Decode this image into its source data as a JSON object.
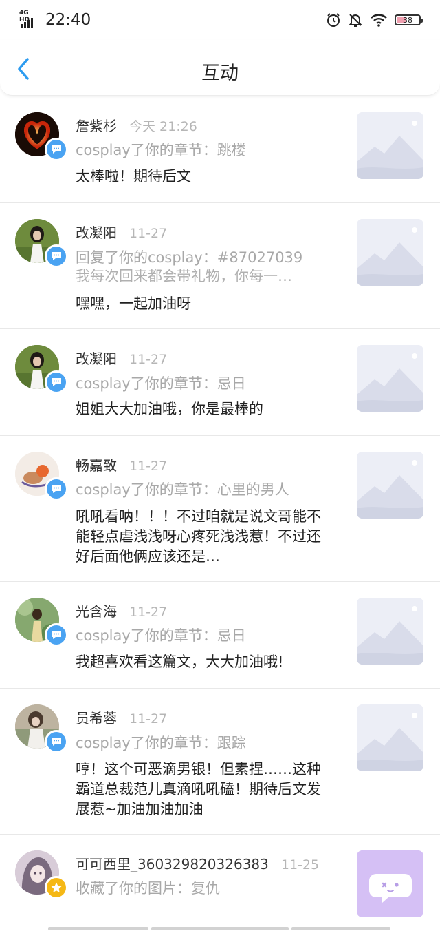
{
  "status_bar": {
    "network": "4G HD",
    "time": "22:40",
    "battery": "38",
    "icons": [
      "alarm-icon",
      "mute-bell-icon",
      "wifi-icon",
      "battery-icon"
    ]
  },
  "header": {
    "title": "互动",
    "back_icon": "chevron-left-icon"
  },
  "colors": {
    "accent": "#4aa3f2",
    "star": "#f5b816",
    "time": "#b6b6b6",
    "action": "#a8a8a8",
    "purple": "#d5c0f5"
  },
  "items": [
    {
      "name": "詹紫杉",
      "time": "今天 21:26",
      "action": "cosplay了你的章节：跳楼",
      "comment": "太棒啦！期待后文",
      "badge": "message-icon"
    },
    {
      "name": "改凝阳",
      "time": "11-27",
      "action": "回复了你的cosplay：#87027039",
      "quote": "我每次回来都会带礼物，你每一…",
      "comment": "嘿嘿，一起加油呀",
      "badge": "message-icon"
    },
    {
      "name": "改凝阳",
      "time": "11-27",
      "action": "cosplay了你的章节：忌日",
      "comment": "姐姐大大加油哦，你是最棒的",
      "badge": "message-icon"
    },
    {
      "name": "畅嘉致",
      "time": "11-27",
      "action": "cosplay了你的章节：心里的男人",
      "comment": "吼吼看呐！！！不过咱就是说文哥能不能轻点虐浅浅呀心疼死浅浅惹！不过还好后面他俩应该还是…",
      "badge": "message-icon"
    },
    {
      "name": "光含海",
      "time": "11-27",
      "action": "cosplay了你的章节：忌日",
      "comment": "我超喜欢看这篇文，大大加油哦!",
      "badge": "message-icon"
    },
    {
      "name": "员希蓉",
      "time": "11-27",
      "action": "cosplay了你的章节：跟踪",
      "comment": "哼！这个可恶滴男银！但素捏……这种霸道总裁范儿真滴吼吼磕！期待后文发展惹~加油加油加油",
      "badge": "message-icon"
    },
    {
      "name": "可可西里_360329820326383",
      "time": "11-25",
      "action": "收藏了你的图片：复仇",
      "badge": "star-icon"
    }
  ]
}
